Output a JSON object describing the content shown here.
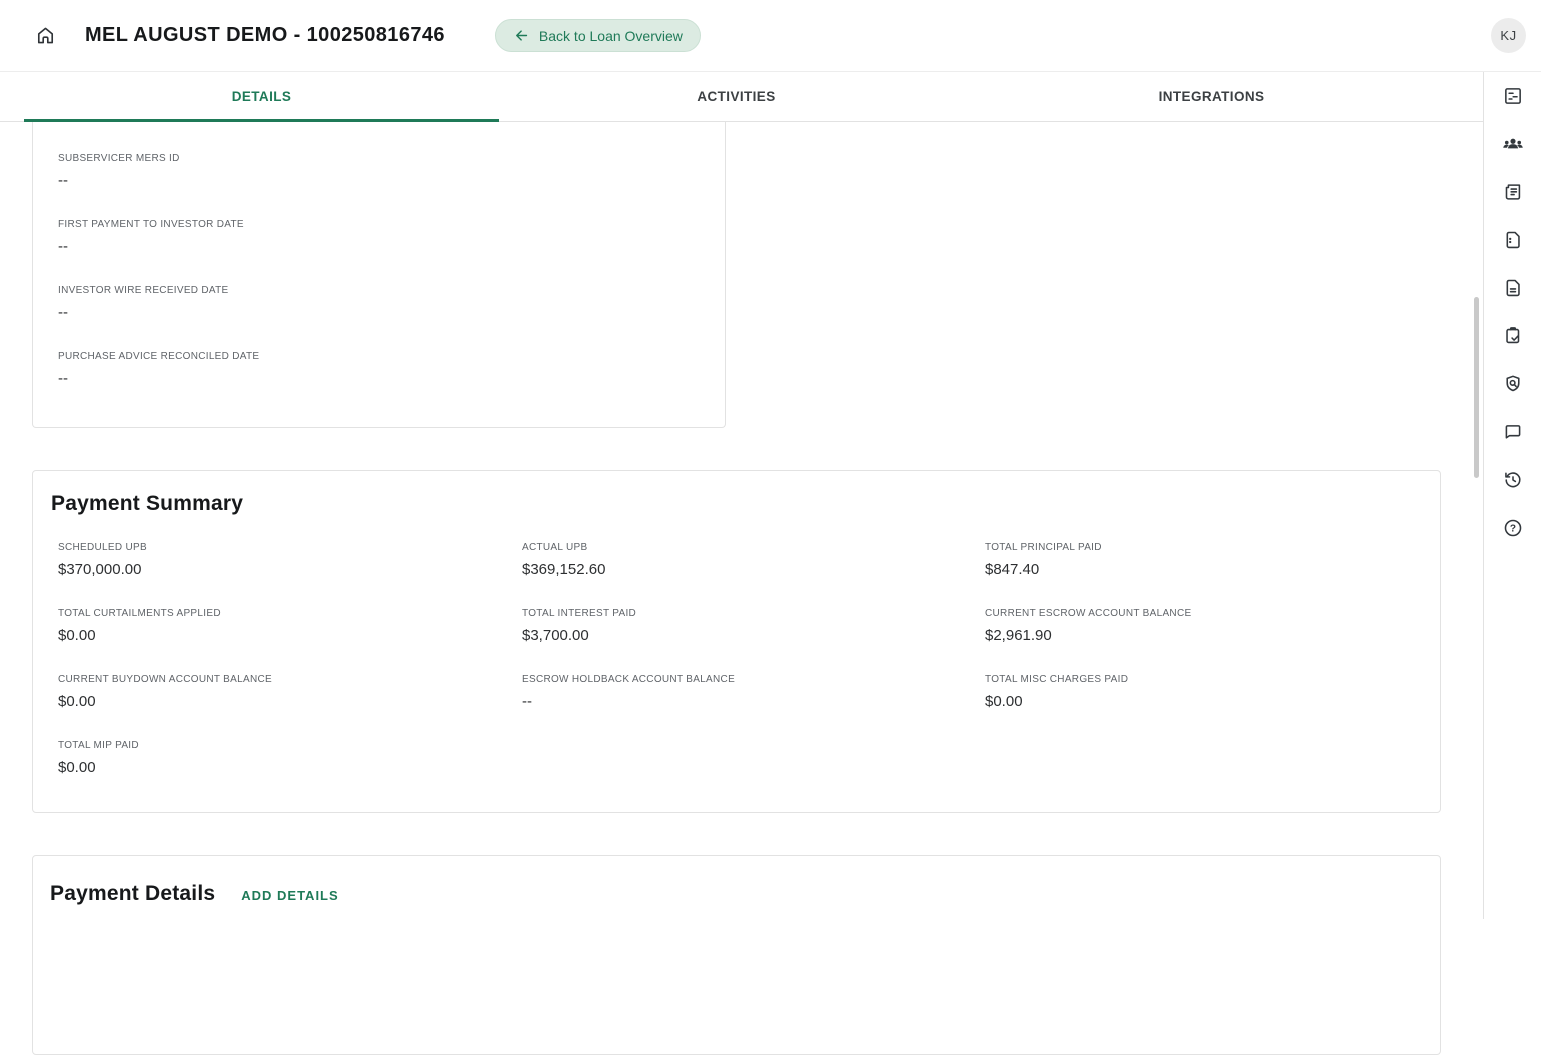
{
  "header": {
    "title": "MEL AUGUST DEMO - 100250816746",
    "back_button_label": "Back to Loan Overview",
    "avatar_initials": "KJ"
  },
  "tabs": [
    {
      "label": "DETAILS",
      "active": true
    },
    {
      "label": "ACTIVITIES",
      "active": false
    },
    {
      "label": "INTEGRATIONS",
      "active": false
    }
  ],
  "colors": {
    "accent_green": "#1f7a58",
    "back_button_bg": "#dcebe2",
    "tab_underline": "#1f7a58"
  },
  "investor_card": {
    "fields": [
      {
        "label": "SUBSERVICER MERS ID",
        "value": "--"
      },
      {
        "label": "FIRST PAYMENT TO INVESTOR DATE",
        "value": "--"
      },
      {
        "label": "INVESTOR WIRE RECEIVED DATE",
        "value": "--"
      },
      {
        "label": "PURCHASE ADVICE RECONCILED DATE",
        "value": "--"
      }
    ]
  },
  "payment_summary": {
    "title": "Payment Summary",
    "fields": [
      {
        "label": "SCHEDULED UPB",
        "value": "$370,000.00"
      },
      {
        "label": "ACTUAL UPB",
        "value": "$369,152.60"
      },
      {
        "label": "TOTAL PRINCIPAL PAID",
        "value": "$847.40"
      },
      {
        "label": "TOTAL CURTAILMENTS APPLIED",
        "value": "$0.00"
      },
      {
        "label": "TOTAL INTEREST PAID",
        "value": "$3,700.00"
      },
      {
        "label": "CURRENT ESCROW ACCOUNT BALANCE",
        "value": "$2,961.90"
      },
      {
        "label": "CURRENT BUYDOWN ACCOUNT BALANCE",
        "value": "$0.00"
      },
      {
        "label": "ESCROW HOLDBACK ACCOUNT BALANCE",
        "value": "--"
      },
      {
        "label": "TOTAL MISC CHARGES PAID",
        "value": "$0.00"
      },
      {
        "label": "TOTAL MIP PAID",
        "value": "$0.00"
      }
    ]
  },
  "payment_details": {
    "title": "Payment Details",
    "add_button_label": "ADD DETAILS"
  },
  "right_rail_icons": [
    "wysiwyg-icon",
    "groups-icon",
    "receipt-icon",
    "contract-icon",
    "document-icon",
    "clipboard-check-icon",
    "policy-shield-icon",
    "chat-icon",
    "history-icon",
    "help-icon"
  ]
}
